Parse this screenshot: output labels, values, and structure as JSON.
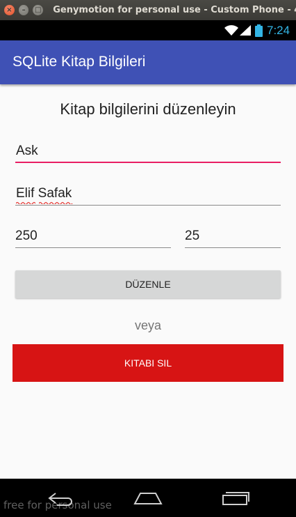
{
  "window": {
    "title": "Genymotion for personal use - Custom Phone - 4"
  },
  "status_bar": {
    "time": "7:24",
    "icons": [
      "wifi-icon",
      "signal-icon",
      "battery-icon"
    ],
    "accent_color": "#33b5e5"
  },
  "app_bar": {
    "title": "SQLite Kitap Bilgileri",
    "color": "#3f51b5"
  },
  "form": {
    "heading": "Kitap bilgilerini düzenleyin",
    "book_title": "Ask",
    "author": "Elif Safak",
    "pages": "250",
    "price": "25",
    "focused_underline_color": "#e91e63"
  },
  "actions": {
    "edit_label": "DÜZENLE",
    "or_label": "veya",
    "delete_label": "KITABI SIL",
    "delete_color": "#d71414"
  },
  "nav_bar": {
    "icons": [
      "back-icon",
      "home-icon",
      "recent-apps-icon"
    ]
  },
  "watermark": "free for personal use"
}
